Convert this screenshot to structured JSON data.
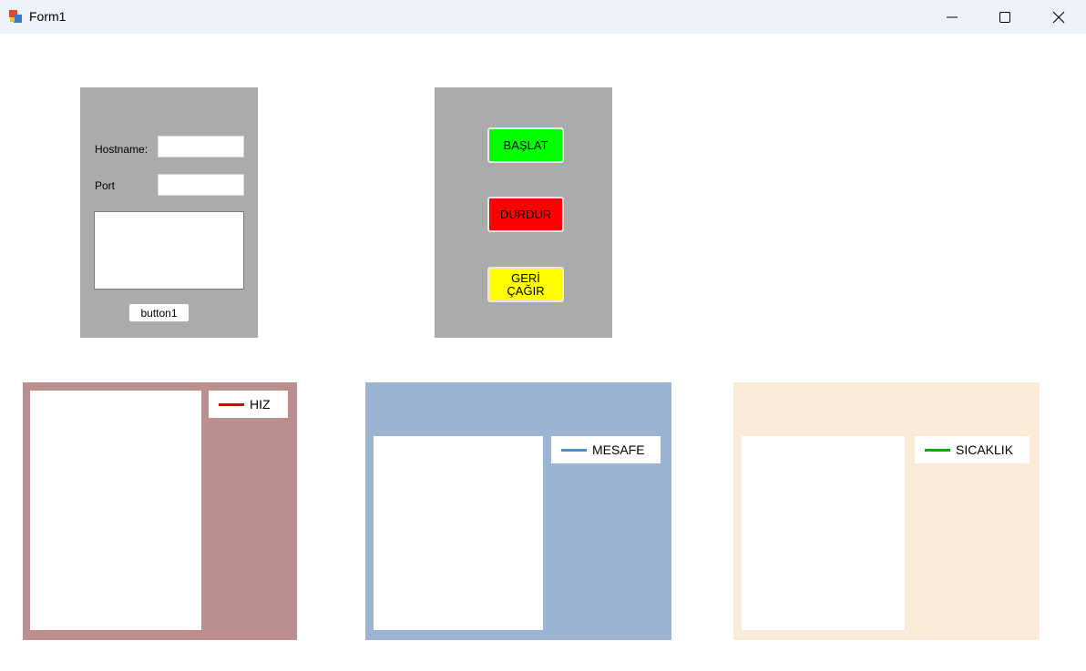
{
  "window": {
    "title": "Form1"
  },
  "connection": {
    "hostname_label": "Hostname:",
    "port_label": "Port",
    "hostname_value": "",
    "port_value": "",
    "log_value": "",
    "button_label": "button1"
  },
  "controls": {
    "start_label": "BAŞLAT",
    "stop_label": "DURDUR",
    "recall_label": "GERİ ÇAĞIR",
    "start_color": "#00ff00",
    "stop_color": "#ff0000",
    "recall_color": "#ffff00"
  },
  "charts": {
    "speed": {
      "legend": "HIZ",
      "color": "#e00000",
      "background": "#bc8f8f"
    },
    "distance": {
      "legend": "MESAFE",
      "color": "#4a90d9",
      "background": "#9ab4d1"
    },
    "temperature": {
      "legend": "SICAKLIK",
      "color": "#00b000",
      "background": "#faebd7"
    }
  },
  "icons": {
    "app": "app-icon",
    "minimize": "minimize-icon",
    "maximize": "maximize-icon",
    "close": "close-icon"
  }
}
